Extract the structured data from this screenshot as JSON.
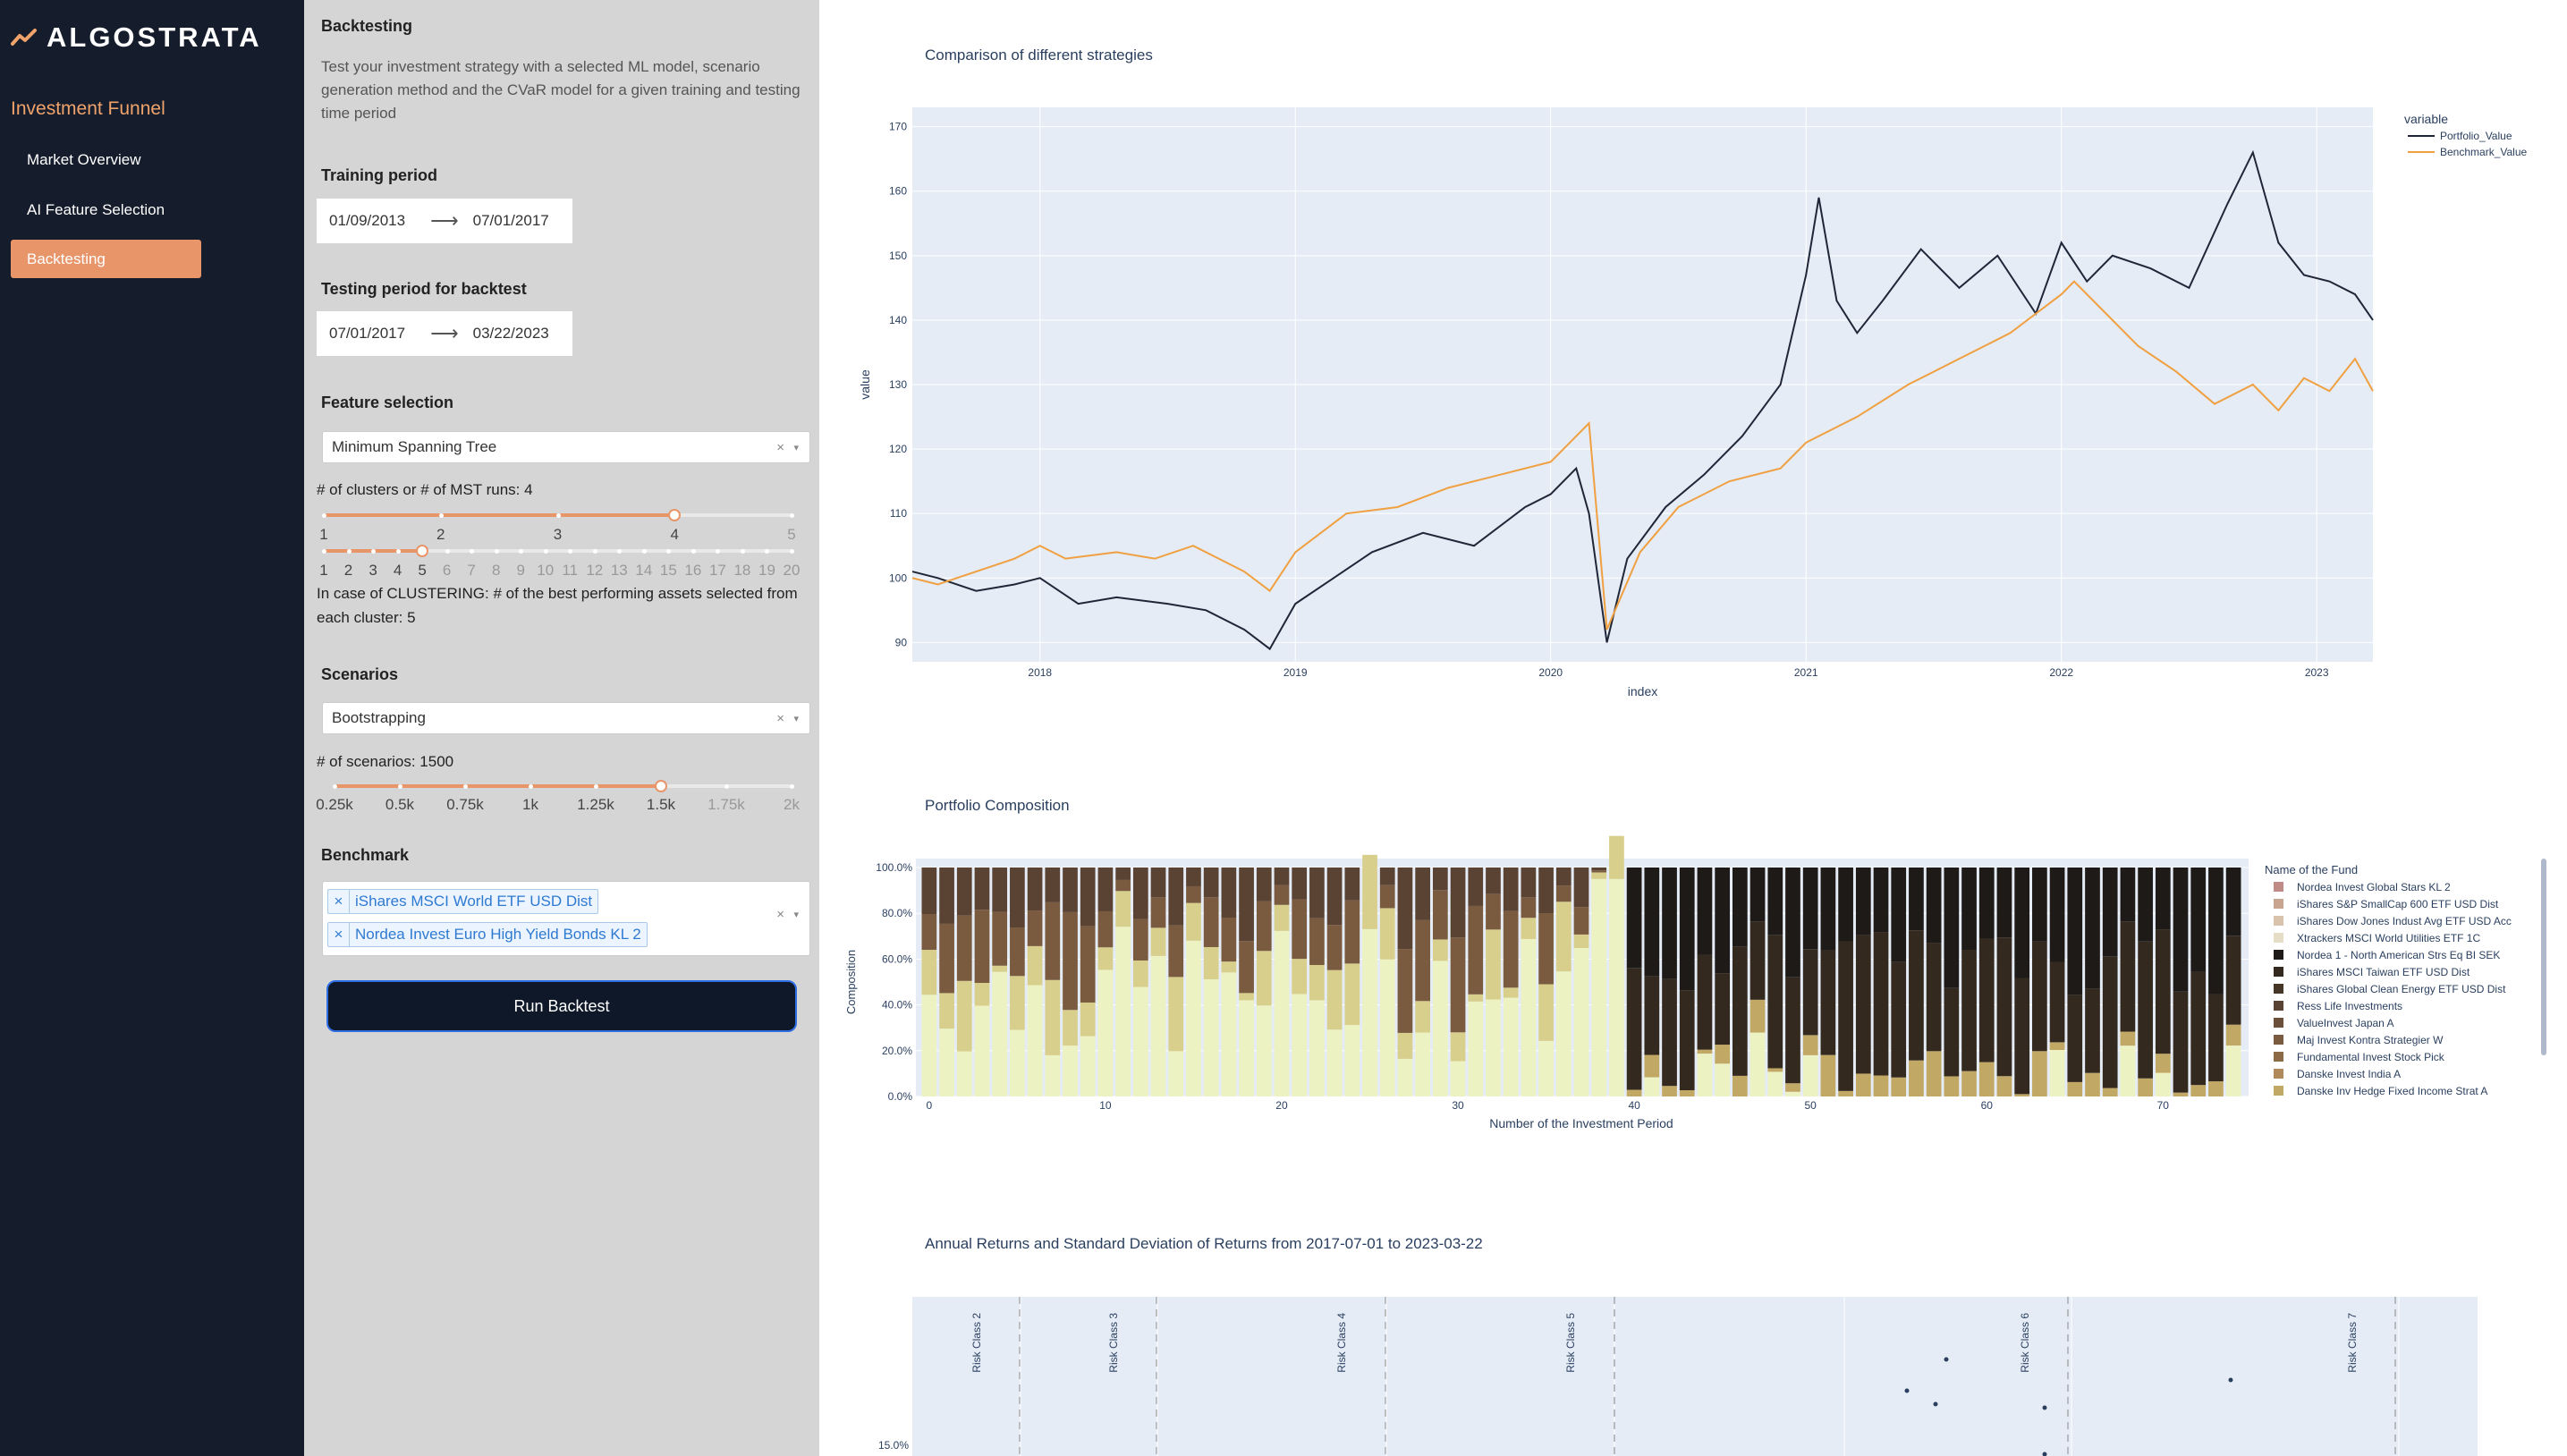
{
  "sidebar": {
    "brand": "ALGOSTRATA",
    "section_title": "Investment Funnel",
    "items": [
      {
        "label": "Market Overview",
        "active": false
      },
      {
        "label": "AI Feature Selection",
        "active": false
      },
      {
        "label": "Backtesting",
        "active": true
      }
    ]
  },
  "panel": {
    "title": "Backtesting",
    "description": "Test your investment strategy with a selected ML model, scenario generation method and the CVaR model for a given training and testing time period",
    "training": {
      "label": "Training period",
      "start": "01/09/2013",
      "end": "07/01/2017"
    },
    "testing": {
      "label": "Testing period for backtest",
      "start": "07/01/2017",
      "end": "03/22/2023"
    },
    "feature": {
      "label": "Feature selection",
      "value": "Minimum Spanning Tree"
    },
    "clusters": {
      "label": "# of clusters or # of MST runs: 4",
      "marks": [
        "1",
        "2",
        "3",
        "4",
        "5"
      ],
      "value": 4
    },
    "best": {
      "marks": [
        "1",
        "2",
        "3",
        "4",
        "5",
        "6",
        "7",
        "8",
        "9",
        "10",
        "11",
        "12",
        "13",
        "14",
        "15",
        "16",
        "17",
        "18",
        "19",
        "20"
      ],
      "value": 5,
      "note": "In case of CLUSTERING: # of the best performing assets selected from each cluster: 5"
    },
    "scenarios": {
      "label": "Scenarios",
      "value": "Bootstrapping"
    },
    "num_scenarios": {
      "label": "# of scenarios: 1500",
      "marks": [
        "0.25k",
        "0.5k",
        "0.75k",
        "1k",
        "1.25k",
        "1.5k",
        "1.75k",
        "2k"
      ],
      "value": 1500
    },
    "benchmark": {
      "label": "Benchmark",
      "tags": [
        "iShares MSCI World ETF USD Dist",
        "Nordea Invest Euro High Yield Bonds KL 2"
      ]
    },
    "run_label": "Run Backtest",
    "clear_glyph": "×",
    "caret_glyph": "▾",
    "arrow_glyph": "⟶"
  },
  "charts": {
    "strategy": {
      "title": "Comparison of different strategies"
    },
    "composition": {
      "title": "Portfolio Composition"
    },
    "risk": {
      "title": "Annual Returns and Standard Deviation of Returns from 2017-07-01 to 2023-03-22"
    }
  },
  "chart_data": [
    {
      "type": "line",
      "title": "Comparison of different strategies",
      "xlabel": "index",
      "ylabel": "value",
      "x_ticks": [
        "2018",
        "2019",
        "2020",
        "2021",
        "2022",
        "2023"
      ],
      "y_ticks": [
        90,
        100,
        110,
        120,
        130,
        140,
        150,
        160,
        170
      ],
      "ylim": [
        87,
        173
      ],
      "xlim": [
        2017.5,
        2023.22
      ],
      "legend_title": "variable",
      "legend_position": "right",
      "grid": true,
      "series": [
        {
          "name": "Portfolio_Value",
          "color": "#1f2637",
          "x": [
            2017.5,
            2017.6,
            2017.75,
            2017.9,
            2018.0,
            2018.15,
            2018.3,
            2018.5,
            2018.65,
            2018.8,
            2018.9,
            2019.0,
            2019.15,
            2019.3,
            2019.5,
            2019.7,
            2019.9,
            2020.0,
            2020.1,
            2020.15,
            2020.22,
            2020.3,
            2020.45,
            2020.6,
            2020.75,
            2020.9,
            2021.0,
            2021.05,
            2021.12,
            2021.2,
            2021.3,
            2021.45,
            2021.6,
            2021.75,
            2021.9,
            2022.0,
            2022.1,
            2022.2,
            2022.35,
            2022.5,
            2022.65,
            2022.75,
            2022.85,
            2022.95,
            2023.05,
            2023.15,
            2023.22
          ],
          "y": [
            101,
            100,
            98,
            99,
            100,
            96,
            97,
            96,
            95,
            92,
            89,
            96,
            100,
            104,
            107,
            105,
            111,
            113,
            117,
            110,
            90,
            103,
            111,
            116,
            122,
            130,
            147,
            159,
            143,
            138,
            143,
            151,
            145,
            150,
            141,
            152,
            146,
            150,
            148,
            145,
            158,
            166,
            152,
            147,
            146,
            144,
            140
          ]
        },
        {
          "name": "Benchmark_Value",
          "color": "#f0a040",
          "x": [
            2017.5,
            2017.6,
            2017.75,
            2017.9,
            2018.0,
            2018.1,
            2018.3,
            2018.45,
            2018.6,
            2018.8,
            2018.9,
            2019.0,
            2019.2,
            2019.4,
            2019.6,
            2019.8,
            2020.0,
            2020.1,
            2020.15,
            2020.22,
            2020.35,
            2020.5,
            2020.7,
            2020.9,
            2021.0,
            2021.2,
            2021.4,
            2021.6,
            2021.8,
            2022.0,
            2022.05,
            2022.15,
            2022.3,
            2022.45,
            2022.6,
            2022.75,
            2022.85,
            2022.95,
            2023.05,
            2023.15,
            2023.22
          ],
          "y": [
            100,
            99,
            101,
            103,
            105,
            103,
            104,
            103,
            105,
            101,
            98,
            104,
            110,
            111,
            114,
            116,
            118,
            122,
            124,
            92,
            104,
            111,
            115,
            117,
            121,
            125,
            130,
            134,
            138,
            144,
            146,
            142,
            136,
            132,
            127,
            130,
            126,
            131,
            129,
            134,
            129
          ]
        }
      ]
    },
    {
      "type": "bar",
      "title": "Portfolio Composition",
      "xlabel": "Number of the Investment Period",
      "ylabel": "Composition",
      "x_ticks": [
        0,
        10,
        20,
        30,
        40,
        50,
        60,
        70
      ],
      "y_ticks": [
        "0.0%",
        "20.0%",
        "40.0%",
        "60.0%",
        "80.0%",
        "100.0%"
      ],
      "stacked": true,
      "legend_title": "Name of the Fund",
      "legend_position": "right",
      "series": [
        {
          "name": "Nordea Invest Global Stars KL 2",
          "color": "#c08a86"
        },
        {
          "name": "iShares S&P SmallCap 600 ETF USD Dist",
          "color": "#c9a590"
        },
        {
          "name": "iShares Dow Jones Indust Avg ETF USD Acc",
          "color": "#d9c3ad"
        },
        {
          "name": "Xtrackers MSCI World Utilities ETF 1C",
          "color": "#e6ddc7"
        },
        {
          "name": "Nordea 1 - North American Strs Eq BI SEK",
          "color": "#1e1a18"
        },
        {
          "name": "iShares MSCI Taiwan ETF USD Dist",
          "color": "#34291f"
        },
        {
          "name": "iShares Global Clean Energy ETF USD Dist",
          "color": "#463628"
        },
        {
          "name": "Ress Life Investments",
          "color": "#5a4333"
        },
        {
          "name": "ValueInvest Japan A",
          "color": "#6a4f3a"
        },
        {
          "name": "Maj Invest Kontra Strategier W",
          "color": "#7a5b40"
        },
        {
          "name": "Fundamental Invest Stock Pick",
          "color": "#8b6a45"
        },
        {
          "name": "Danske Invest India A",
          "color": "#b08a5a"
        },
        {
          "name": "Danske Inv Hedge Fixed Income Strat A",
          "color": "#c2a865"
        }
      ]
    },
    {
      "type": "scatter",
      "title": "Annual Returns and Standard Deviation of Returns from 2017-07-01 to 2023-03-22",
      "y_ticks": [
        "15.0%"
      ],
      "annotations": [
        "Risk Class 2",
        "Risk Class 3",
        "Risk Class 4",
        "Risk Class 5",
        "Risk Class 6",
        "Risk Class 7"
      ]
    }
  ]
}
